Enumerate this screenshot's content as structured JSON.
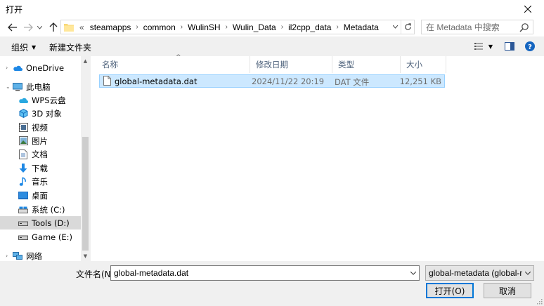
{
  "window": {
    "title": "打开",
    "close_icon": "close-icon"
  },
  "address": {
    "overflow": "«",
    "crumbs": [
      "steamapps",
      "common",
      "WulinSH",
      "Wulin_Data",
      "il2cpp_data",
      "Metadata"
    ],
    "search_placeholder": "在 Metadata 中搜索"
  },
  "toolbar": {
    "organize": "组织",
    "new_folder": "新建文件夹"
  },
  "nav": {
    "items": [
      {
        "label": "OneDrive",
        "icon": "cloud-icon"
      },
      {
        "label": "此电脑",
        "icon": "computer-icon"
      },
      {
        "label": "WPS云盘",
        "icon": "cloud-icon"
      },
      {
        "label": "3D 对象",
        "icon": "cube-icon"
      },
      {
        "label": "视频",
        "icon": "video-icon"
      },
      {
        "label": "图片",
        "icon": "picture-icon"
      },
      {
        "label": "文档",
        "icon": "document-icon"
      },
      {
        "label": "下载",
        "icon": "download-icon"
      },
      {
        "label": "音乐",
        "icon": "music-icon"
      },
      {
        "label": "桌面",
        "icon": "desktop-icon"
      },
      {
        "label": "系统 (C:)",
        "icon": "drive-icon"
      },
      {
        "label": "Tools (D:)",
        "icon": "drive-icon"
      },
      {
        "label": "Game (E:)",
        "icon": "drive-icon"
      },
      {
        "label": "网络",
        "icon": "network-icon"
      }
    ],
    "selected": "Tools (D:)"
  },
  "columns": [
    "名称",
    "修改日期",
    "类型",
    "大小"
  ],
  "files": [
    {
      "name": "global-metadata.dat",
      "modified": "2024/11/22 20:19",
      "type": "DAT 文件",
      "size": "12,251 KB",
      "icon": "file-icon"
    }
  ],
  "bottom": {
    "filename_label": "文件名(N):",
    "filename_value": "global-metadata.dat",
    "filetype_value": "global-metadata (global-metadata.dat)",
    "open_label": "打开(O)",
    "cancel_label": "取消"
  },
  "colors": {
    "selection": "#cce8ff",
    "selection_border": "#99d1ff",
    "accent": "#0078d7",
    "header_text": "#4c607a"
  }
}
